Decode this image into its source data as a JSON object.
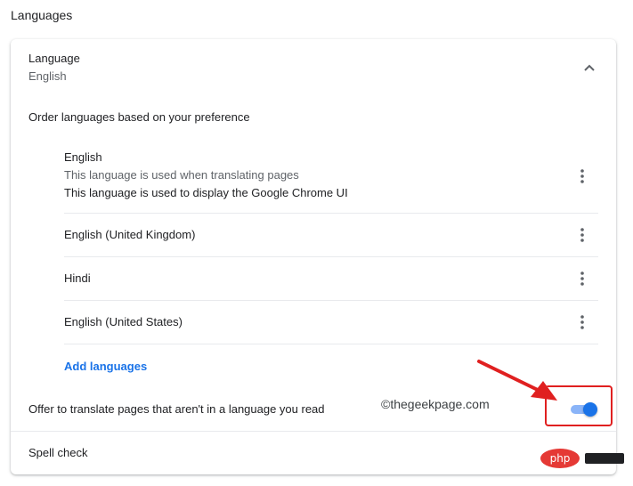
{
  "section": {
    "title": "Languages"
  },
  "language_header": {
    "label": "Language",
    "value": "English",
    "chevron_icon": "chevron-up-icon"
  },
  "order_text": "Order languages based on your preference",
  "languages": [
    {
      "name": "English",
      "notes": [
        "This language is used when translating pages",
        "This language is used to display the Google Chrome UI"
      ]
    },
    {
      "name": "English (United Kingdom)"
    },
    {
      "name": "Hindi"
    },
    {
      "name": "English (United States)"
    }
  ],
  "add_languages_label": "Add languages",
  "offer_translate": {
    "label": "Offer to translate pages that aren't in a language you read",
    "enabled": true
  },
  "watermark_text": "©thegeekpage.com",
  "spell_check_label": "Spell check",
  "logo_badge_text": "php",
  "colors": {
    "accent": "#1a73e8",
    "toggle_track": "#8ab4f8",
    "annotation_red": "#e02020",
    "secondary_text": "#5f6368"
  }
}
